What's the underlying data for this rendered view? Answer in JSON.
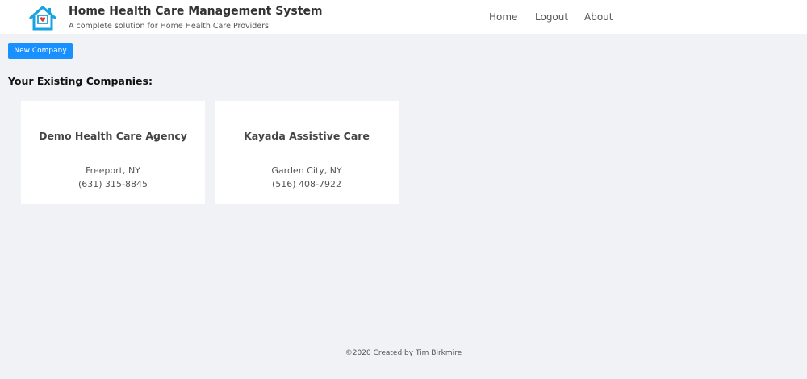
{
  "header": {
    "title": "Home Health Care Management System",
    "subtitle": "A complete solution for Home Health Care Providers",
    "logo_icon": "house-heart-icon",
    "nav": {
      "home": "Home",
      "logout": "Logout",
      "about": "About"
    }
  },
  "toolbar": {
    "new_company_label": "New Company"
  },
  "main": {
    "heading": "Your Existing Companies:",
    "companies": [
      {
        "name": "Demo Health Care Agency",
        "location": "Freeport, NY",
        "phone": "(631) 315-8845"
      },
      {
        "name": "Kayada Assistive Care",
        "location": "Garden City, NY",
        "phone": "(516) 408-7922"
      }
    ]
  },
  "footer": {
    "text": "©2020 Created by Tim Birkmire"
  },
  "colors": {
    "accent": "#1890ff",
    "background": "#f0f2f5",
    "logo_blue": "#1aa3e0",
    "logo_heart": "#e53935"
  }
}
